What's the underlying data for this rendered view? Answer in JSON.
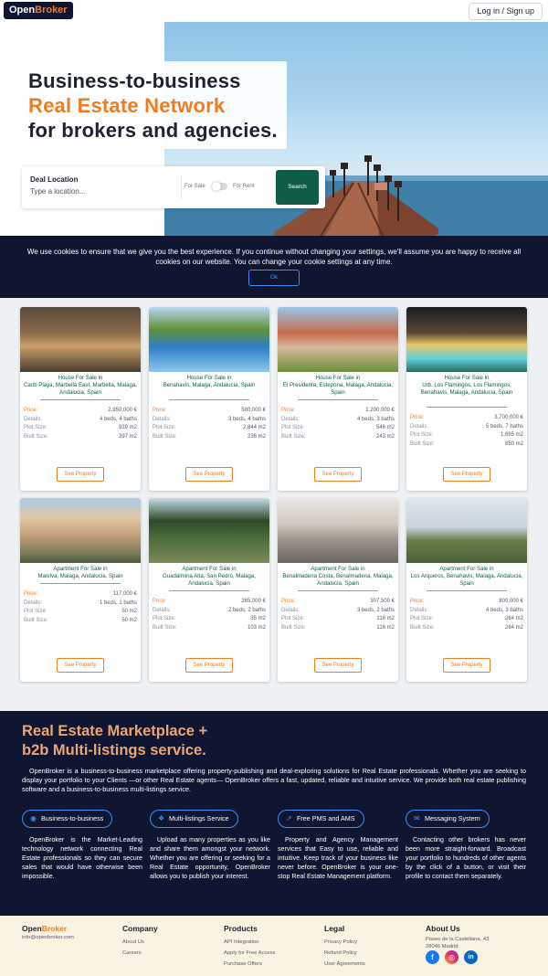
{
  "header": {
    "logo_part1": "Open",
    "logo_part2": "Broker",
    "login_label": "Log in / Sign up"
  },
  "hero": {
    "headline_1": "Business-to-business",
    "headline_2": "Real Estate Network",
    "headline_3": "for brokers and agencies.",
    "search": {
      "label": "Deal Location",
      "placeholder": "Type a location...",
      "toggle_left": "For Sale",
      "toggle_right": "For Rent",
      "button": "Search"
    }
  },
  "cookie": {
    "text": "We use cookies to ensure that we give you the best experience. If you continue without changing your settings, we'll assume you are happy to receive all cookies on our website. You can change your cookie settings at any time.",
    "ok": "Ok"
  },
  "listing_labels": {
    "price": "Price:",
    "details": "Details:",
    "plot": "Plot Size:",
    "built": "Built Size:",
    "button": "See Property"
  },
  "listings": [
    {
      "title": "House For Sale in\nCarib Playa, Marbella East, Marbella, Malaga, Andalucia, Spain",
      "price": "2,950,000 €",
      "details": "4 beds, 4 baths",
      "plot": "939 m2",
      "built": "397 m2"
    },
    {
      "title": "House For Sale in\nBenahavis, Malaga, Andalucia, Spain",
      "price": "580,000 €",
      "details": "3 beds, 4 baths",
      "plot": "2,844 m2",
      "built": "236 m2"
    },
    {
      "title": "House For Sale in\nEl Presidente, Estepona, Malaga, Andalucia, Spain",
      "price": "1,200,000 €",
      "details": "4 beds, 3 baths",
      "plot": "546 m2",
      "built": "243 m2"
    },
    {
      "title": "House For Sale in\nUrb. Los Flamingos, Los Flamingos, Benahavis, Malaga, Andalucia, Spain",
      "price": "3,700,000 €",
      "details": "5 beds, 7 baths",
      "plot": "1,695 m2",
      "built": "850 m2"
    },
    {
      "title": "Apartment For Sale in\nManilva, Malaga, Andalucia, Spain",
      "price": "117,000 €",
      "details": "1 beds, 1 baths",
      "plot": "50 m2",
      "built": "50 m2"
    },
    {
      "title": "Apartment For Sale in\nGuadalmina Alta, San Pedro, Malaga, Andalucia, Spain",
      "price": "265,000 €",
      "details": "2 beds, 2 baths",
      "plot": "35 m2",
      "built": "103 m2"
    },
    {
      "title": "Apartment For Sale in\nBenalmadena Costa, Benalmadena, Malaga, Andalucia, Spain",
      "price": "307,500 €",
      "details": "3 beds, 2 baths",
      "plot": "116 m2",
      "built": "116 m2"
    },
    {
      "title": "Apartment For Sale in\nLos Arqueros, Benahavis, Malaga, Andalucia, Spain",
      "price": "800,000 €",
      "details": "4 beds, 3 baths",
      "plot": "264 m2",
      "built": "264 m2"
    }
  ],
  "market": {
    "title_1": "Real Estate Marketplace +",
    "title_2": "b2b Multi-listings service.",
    "description": "OpenBroker is a business-to-business marketplace offering property-publishing and deal-exploring solutions for Real Estate professionals. Whether you are seeking to display your portfolio to your Clients —or other Real Estate agents— OpenBroker offers a fast, updated, reliable and intuitive service. We provide both real estate publishing software and a business-to-business multi-listings service.",
    "features": [
      {
        "label": "Business-to-business",
        "text": "OpenBroker is the Market-Leading technology network connecting Real Estate professionals so they can secure sales that would have otherwise been impossible."
      },
      {
        "label": "Multi-listings Service",
        "text": "Upload as many properties as you like and share them amongst your network. Whether you are offering or seeking for a Real Estate opportunity, OpenBroker allows you to publish your interest."
      },
      {
        "label": "Free PMS and AMS",
        "text": "Property and Agency Management services that Easy to use, reliable and intuitive. Keep track of your business like never before. OpenBroker is your one-stop Real Estate Management platform."
      },
      {
        "label": "Messaging System",
        "text": "Contacting other brokers has never been more straight-forward. Broadcast your portfolio to hundreds of other agents by the click of a button, or visit their profile to contact them separately."
      }
    ]
  },
  "footer": {
    "logo_part1": "Open",
    "logo_part2": "Broker",
    "email": "info@openbroker.com",
    "company": {
      "heading": "Company",
      "links": [
        "About Us",
        "Careers"
      ]
    },
    "products": {
      "heading": "Products",
      "links": [
        "API Integration",
        "Apply for Free Access",
        "Purchase Offers"
      ]
    },
    "legal": {
      "heading": "Legal",
      "links": [
        "Privacy Policy",
        "Refund Policy",
        "User Agreements"
      ]
    },
    "about": {
      "heading": "About Us",
      "address_1": "Paseo de la Castellana, 43",
      "address_2": "28046 Madrid"
    },
    "social": {
      "facebook": "f",
      "instagram": "◎",
      "linkedin": "in"
    },
    "colors": {
      "facebook": "#1877f2",
      "instagram": "#e1306c",
      "linkedin": "#0a66c2"
    }
  },
  "colors": {
    "navy": "#101632",
    "orange": "#f07c22",
    "green": "#0f5c49",
    "blue": "#3e8ef7"
  }
}
